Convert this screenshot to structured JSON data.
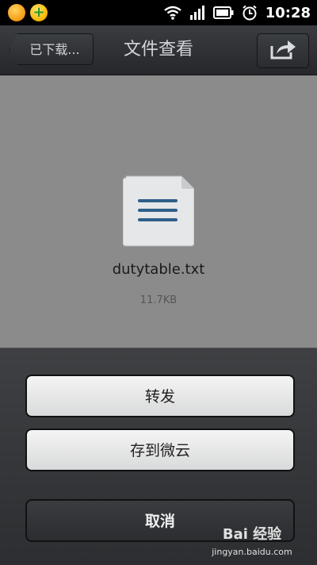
{
  "status_bar": {
    "time": "10:28",
    "icons": [
      "orange-app-icon",
      "plus-app-icon",
      "wifi-icon",
      "signal-icon",
      "battery-icon",
      "alarm-icon"
    ]
  },
  "header": {
    "back_label": "已下载...",
    "title": "文件查看",
    "share_icon": "share-icon"
  },
  "file": {
    "name": "dutytable.txt",
    "size": "11.7KB",
    "icon": "text-file-icon"
  },
  "actions": {
    "forward_label": "转发",
    "save_label": "存到微云",
    "cancel_label": "取消"
  },
  "watermark": {
    "logo_text": "Bai 经验",
    "url": "jingyan.baidu.com"
  },
  "colors": {
    "status_bar": "#000000",
    "title_bar": "#2e3033",
    "preview_bg": "#8b8b8b",
    "sheet_bg": "#35373a"
  }
}
